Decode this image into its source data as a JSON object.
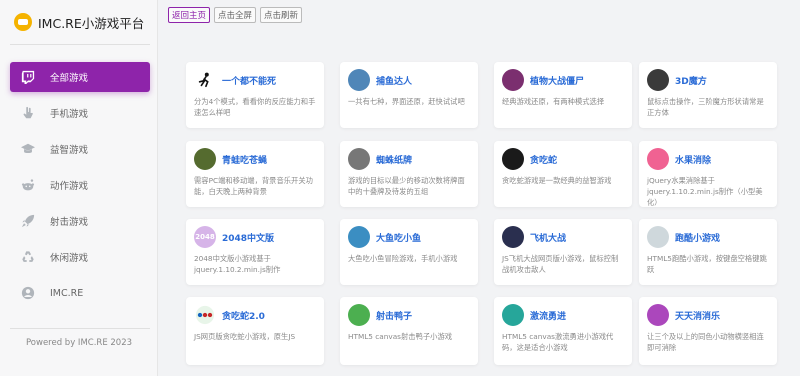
{
  "brand": {
    "title": "IMC.RE小游戏平台"
  },
  "toolbar": {
    "home": "返回主页",
    "fullscreen": "点击全屏",
    "refresh": "点击刷新"
  },
  "nav": [
    {
      "label": "全部游戏",
      "icon": "twitch-icon"
    },
    {
      "label": "手机游戏",
      "icon": "hand-icon"
    },
    {
      "label": "益智游戏",
      "icon": "graduation-cap-icon"
    },
    {
      "label": "动作游戏",
      "icon": "reddit-icon"
    },
    {
      "label": "射击游戏",
      "icon": "rocket-icon"
    },
    {
      "label": "休闲游戏",
      "icon": "recycle-icon"
    },
    {
      "label": "IMC.RE",
      "icon": "user-circle-icon"
    }
  ],
  "footer": "Powered by IMC.RE 2023",
  "games": [
    {
      "name": "一个都不能死",
      "desc": "分为4个模式，看看你的反应能力和手速怎么样吧",
      "thumb_color": "#ffffff",
      "thumb_text": ""
    },
    {
      "name": "捕鱼达人",
      "desc": "一共有七种，界面还原，赶快试试吧",
      "thumb_color": "#4f86b8",
      "thumb_text": ""
    },
    {
      "name": "植物大战僵尸",
      "desc": "经典游戏还原，有两种模式选择",
      "thumb_color": "#7b2f6f",
      "thumb_text": ""
    },
    {
      "name": "3D魔方",
      "desc": "鼠标点击操作，三阶魔方形状请常是正方体",
      "thumb_color": "#3a3a3a",
      "thumb_text": ""
    },
    {
      "name": "青蛙吃苍蝇",
      "desc": "需容PC端和移动端，背景音乐开关功能，白天晚上两种背景",
      "thumb_color": "#556b2f",
      "thumb_text": ""
    },
    {
      "name": "蜘蛛纸牌",
      "desc": "游戏的目标以最少的移动次数将牌面中的十叠牌及待发的五组",
      "thumb_color": "#777777",
      "thumb_text": ""
    },
    {
      "name": "贪吃蛇",
      "desc": "贪吃蛇游戏是一款经典的益智游戏",
      "thumb_color": "#1a1a1a",
      "thumb_text": ""
    },
    {
      "name": "水果消除",
      "desc": "jQuery水果消除基于jquery.1.10.2.min.js制作（小型美化）",
      "thumb_color": "#f06292",
      "thumb_text": ""
    },
    {
      "name": "2048中文版",
      "desc": "2048中文版小游戏基于jquery.1.10.2.min.js制作",
      "thumb_color": "#d6b4e8",
      "thumb_text": "2048"
    },
    {
      "name": "大鱼吃小鱼",
      "desc": "大鱼吃小鱼冒险游戏，手机小游戏",
      "thumb_color": "#3b8ec2",
      "thumb_text": ""
    },
    {
      "name": "飞机大战",
      "desc": "JS飞机大战网页版小游戏，鼠标控制战机攻击敌人",
      "thumb_color": "#2a2f4f",
      "thumb_text": ""
    },
    {
      "name": "跑酷小游戏",
      "desc": "HTML5跑酷小游戏，按键盘空格键跳跃",
      "thumb_color": "#cfd8dc",
      "thumb_text": ""
    },
    {
      "name": "贪吃蛇2.0",
      "desc": "JS网页版贪吃蛇小游戏，原生JS",
      "thumb_color": "#8bc34a",
      "thumb_text": ""
    },
    {
      "name": "射击鸭子",
      "desc": "HTML5 canvas射击鸭子小游戏",
      "thumb_color": "#4caf50",
      "thumb_text": ""
    },
    {
      "name": "激流勇进",
      "desc": "HTML5 canvas激流勇进小游戏代码，这是适合小游戏",
      "thumb_color": "#26a69a",
      "thumb_text": ""
    },
    {
      "name": "天天消消乐",
      "desc": "让三个及以上的同色小动物横竖相连即可消除",
      "thumb_color": "#ab47bc",
      "thumb_text": ""
    }
  ]
}
